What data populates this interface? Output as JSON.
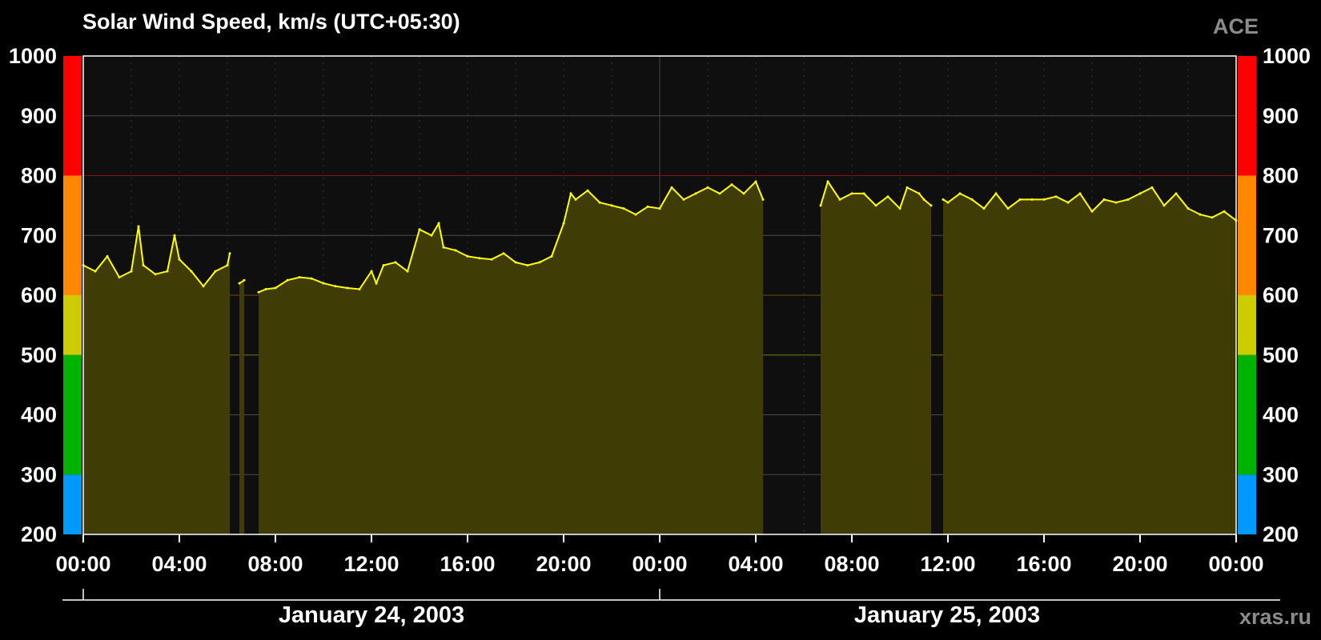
{
  "header": {
    "title": "Solar Wind Speed, km/s (UTC+05:30)",
    "brand": "ACE"
  },
  "footer": {
    "site": "xras.ru",
    "dates": [
      "January 24, 2003",
      "January 25, 2003"
    ]
  },
  "colors": {
    "background": "#000000",
    "plot_bg": "#0f0f0f",
    "line": "#ffff00",
    "fill": "#3f3c06",
    "grid": "#4a4a4a",
    "scale_bands": [
      "#0099ff",
      "#00b300",
      "#cccc00",
      "#ff8800",
      "#ff0000"
    ]
  },
  "chart_data": {
    "type": "area",
    "title": "Solar Wind Speed, km/s (UTC+05:30)",
    "xlabel": "",
    "ylabel": "",
    "ylim": [
      200,
      1000
    ],
    "xlim_hours": [
      0,
      48
    ],
    "yticks": [
      200,
      300,
      400,
      500,
      600,
      700,
      800,
      900,
      1000
    ],
    "xtick_labels": [
      "00:00",
      "04:00",
      "08:00",
      "12:00",
      "16:00",
      "20:00",
      "00:00",
      "04:00",
      "08:00",
      "12:00",
      "16:00",
      "20:00",
      "00:00"
    ],
    "xtick_hours": [
      0,
      4,
      8,
      12,
      16,
      20,
      24,
      28,
      32,
      36,
      40,
      44,
      48
    ],
    "threshold_lines": [
      500,
      600,
      800
    ],
    "scale_bands": [
      {
        "from": 200,
        "to": 300
      },
      {
        "from": 300,
        "to": 500
      },
      {
        "from": 500,
        "to": 600
      },
      {
        "from": 600,
        "to": 800
      },
      {
        "from": 800,
        "to": 1000
      }
    ],
    "grid": true,
    "series": [
      {
        "x_hours": [
          0,
          0.5,
          1,
          1.5,
          2,
          2.3,
          2.5,
          3,
          3.5,
          3.8,
          4,
          4.5,
          5,
          5.5,
          6,
          6.1,
          null,
          6.5,
          6.7,
          null,
          7.3,
          7.6,
          8,
          8.5,
          9,
          9.5,
          10,
          10.5,
          11,
          11.5,
          12,
          12.2,
          12.5,
          13,
          13.5,
          14,
          14.5,
          14.8,
          15,
          15.5,
          16,
          16.5,
          17,
          17.5,
          18,
          18.5,
          19,
          19.5,
          20,
          20.3,
          20.5,
          21,
          21.5,
          22,
          22.5,
          23,
          23.5,
          24,
          24.5,
          25,
          25.5,
          26,
          26.5,
          27,
          27.5,
          28,
          28.3,
          null,
          30.7,
          31,
          31.5,
          32,
          32.5,
          33,
          33.5,
          34,
          34.3,
          34.8,
          35,
          35.3,
          null,
          35.8,
          36,
          36.5,
          37,
          37.5,
          38,
          38.5,
          39,
          39.5,
          40,
          40.5,
          41,
          41.5,
          42,
          42.5,
          43,
          43.5,
          44,
          44.5,
          45,
          45.5,
          46,
          46.5,
          47,
          47.5,
          48
        ],
        "values": [
          650,
          640,
          665,
          630,
          640,
          715,
          650,
          635,
          640,
          700,
          660,
          640,
          615,
          640,
          650,
          670,
          null,
          620,
          625,
          null,
          605,
          610,
          612,
          625,
          630,
          628,
          620,
          615,
          612,
          610,
          640,
          620,
          650,
          655,
          640,
          710,
          700,
          720,
          680,
          675,
          665,
          662,
          660,
          670,
          655,
          650,
          655,
          665,
          720,
          770,
          760,
          775,
          755,
          750,
          745,
          735,
          748,
          745,
          780,
          760,
          770,
          780,
          770,
          785,
          770,
          790,
          760,
          null,
          750,
          790,
          760,
          770,
          770,
          750,
          765,
          745,
          780,
          770,
          760,
          750,
          null,
          760,
          755,
          770,
          760,
          745,
          770,
          745,
          760,
          760,
          760,
          765,
          755,
          770,
          740,
          760,
          755,
          760,
          770,
          780,
          750,
          770,
          745,
          735,
          730,
          740,
          725
        ]
      }
    ]
  }
}
